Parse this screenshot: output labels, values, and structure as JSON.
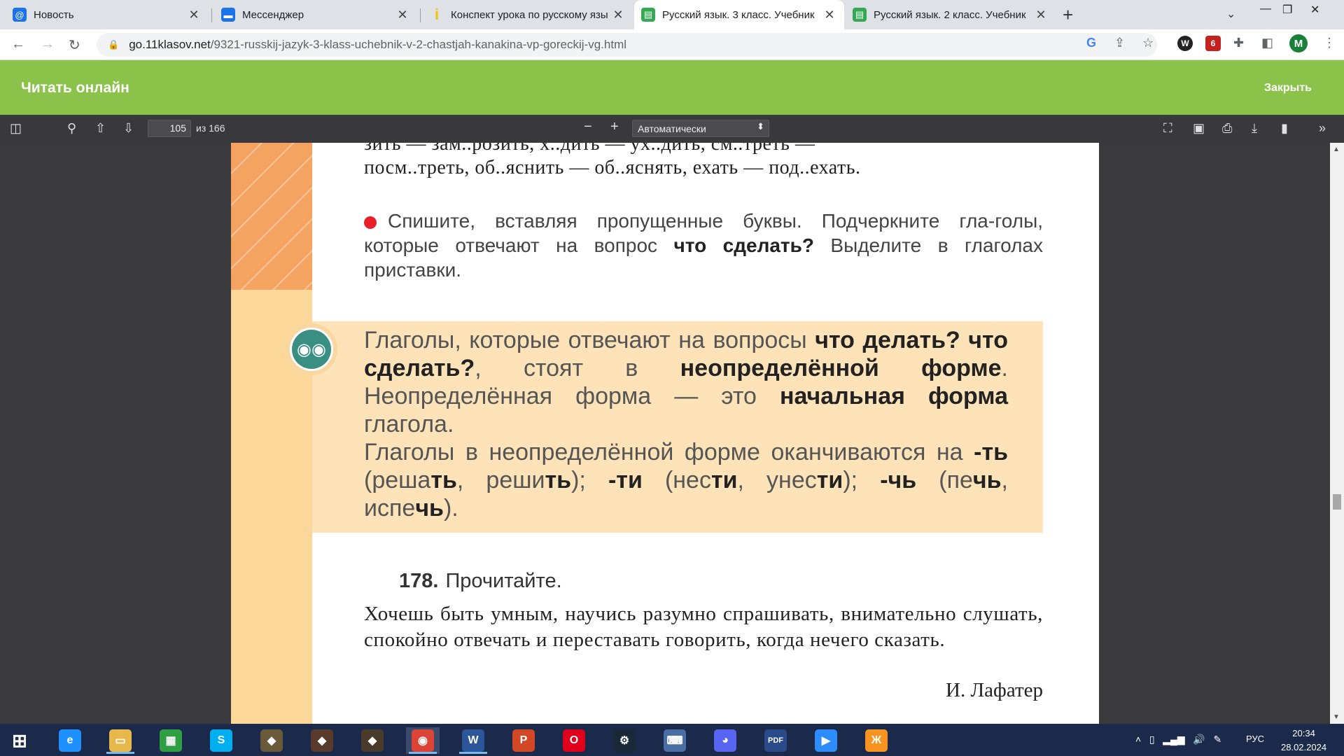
{
  "browser": {
    "tabs": [
      {
        "title": "Новость",
        "icon": "mail-at-icon",
        "color": "#1a73e8"
      },
      {
        "title": "Мессенджер",
        "icon": "chat-bubble-icon",
        "color": "#1a73e8"
      },
      {
        "title": "Конспект урока по русскому язы",
        "icon": "doc-icon",
        "color": "#f4c20d"
      },
      {
        "title": "Русский язык. 3 класс. Учебник",
        "icon": "book-icon",
        "color": "#34a853"
      },
      {
        "title": "Русский язык. 2 класс. Учебник",
        "icon": "book-icon",
        "color": "#34a853"
      }
    ],
    "new_tab": "+",
    "url_domain": "go.11klasov.net",
    "url_path": "/9321-russkij-jazyk-3-klass-uchebnik-v-2-chastjah-kanakina-vp-goreckij-vg.html",
    "profile_initial": "M",
    "ext_badge": "6"
  },
  "header": {
    "brand": "Читать онлайн",
    "close": "Закрыть"
  },
  "pdf": {
    "page": "105",
    "total": "из 166",
    "zoom": "Автоматически"
  },
  "content": {
    "line1": "зить — зам..розить, х..дить — ух..дить, см..треть —",
    "line2": "посм..треть, об..яснить — об..яснять, ехать — под..ехать.",
    "task_a": "Спишите, вставляя пропущенные буквы. Подчеркните гла-голы, которые отвечают на вопрос ",
    "task_b": "что сделать?",
    "task_c": " Выделите в глаголах приставки.",
    "rule": {
      "p1": "Глаголы, которые отвечают на вопросы ",
      "b1": "что делать? что сделать?",
      "p2": ", стоят в ",
      "b2": "неопределённой форме",
      "p3": ". Неопределённая форма — это ",
      "b3": "начальная форма",
      "p4": " глагола.",
      "p5": "Глаголы в неопределённой форме оканчиваются на ",
      "b4": "-ть",
      "p6": " (реша",
      "b5": "ть",
      "p7": ", реши",
      "b6": "ть",
      "p8": "); ",
      "b7": "-ти",
      "p9": " (нес",
      "b8": "ти",
      "p10": ", унес",
      "b9": "ти",
      "p11": "); ",
      "b10": "-чь",
      "p12": " (пе",
      "b11": "чь",
      "p13": ", испе",
      "b12": "чь",
      "p14": ")."
    },
    "exercise_number": "178.",
    "exercise_title": "Прочитайте.",
    "quote": "Хочешь быть умным, научись разумно спрашивать, внимательно слушать, спокойно отвечать и переставать говорить, когда нечего сказать.",
    "author": "И. Лафатер"
  },
  "taskbar": {
    "apps": [
      {
        "name": "ie-icon",
        "color": "#1e90ff",
        "glyph": "e"
      },
      {
        "name": "explorer-icon",
        "color": "#e8b84a",
        "glyph": "▭"
      },
      {
        "name": "store-icon",
        "color": "#2ea043",
        "glyph": "▦"
      },
      {
        "name": "skype-icon",
        "color": "#00aff0",
        "glyph": "S"
      },
      {
        "name": "game1-icon",
        "color": "#6b5a3a",
        "glyph": "◆"
      },
      {
        "name": "game2-icon",
        "color": "#5a3a2a",
        "glyph": "◆"
      },
      {
        "name": "game3-icon",
        "color": "#4a3a2a",
        "glyph": "◆"
      },
      {
        "name": "chrome-icon",
        "color": "#db4437",
        "glyph": "◉"
      },
      {
        "name": "word-icon",
        "color": "#2b579a",
        "glyph": "W"
      },
      {
        "name": "powerpoint-icon",
        "color": "#d24726",
        "glyph": "P"
      },
      {
        "name": "opera-icon",
        "color": "#e0001b",
        "glyph": "O"
      },
      {
        "name": "steam-icon",
        "color": "#1b2838",
        "glyph": "⚙"
      },
      {
        "name": "keyboard-icon",
        "color": "#4a6fa5",
        "glyph": "⌨"
      },
      {
        "name": "discord-icon",
        "color": "#5865f2",
        "glyph": "◕"
      },
      {
        "name": "pdf-icon",
        "color": "#2a4a8a",
        "glyph": "PDF"
      },
      {
        "name": "zoom-icon",
        "color": "#2d8cff",
        "glyph": "▶"
      },
      {
        "name": "odnoklassniki-icon",
        "color": "#f7931e",
        "glyph": "Ж"
      }
    ],
    "lang": "РУС",
    "time": "20:34",
    "date": "28.02.2024"
  }
}
